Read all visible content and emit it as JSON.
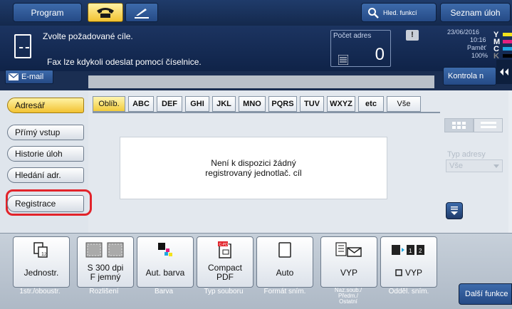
{
  "topbar": {
    "program_label": "Program",
    "search_label": "Hled. funkcí",
    "job_list_label": "Seznam úloh"
  },
  "info": {
    "line1": "Zvolte požadované cíle.",
    "line2": "Fax lze kdykoli odeslat pomocí číselnice.",
    "address_count_label": "Počet adres",
    "address_count": "0",
    "date": "23/06/2016",
    "time": "10:16",
    "memory_label": "Paměť",
    "memory_value": "100%",
    "toner": {
      "y": "Y",
      "m": "M",
      "c": "C",
      "k": "K"
    },
    "toner_colors": {
      "y": "#f3e21c",
      "m": "#e2207f",
      "c": "#1fa6e0",
      "k": "#000000"
    }
  },
  "strip": {
    "email_label": "E-mail",
    "check_label": "Kontrola n"
  },
  "left_menu": [
    {
      "label": "Adresář",
      "active": true
    },
    {
      "label": "Přímý vstup",
      "active": false
    },
    {
      "label": "Historie úloh",
      "active": false
    },
    {
      "label": "Hledání adr.",
      "active": false
    },
    {
      "label": "Registrace",
      "active": false
    }
  ],
  "tabs": [
    "Oblíb.",
    "ABC",
    "DEF",
    "GHI",
    "JKL",
    "MNO",
    "PQRS",
    "TUV",
    "WXYZ",
    "etc",
    "Vše"
  ],
  "message": {
    "line1": "Není k dispozici žádný",
    "line2": "registrovaný jednotlač. cíl"
  },
  "address_type": {
    "label": "Typ adresy",
    "value": "Vše"
  },
  "functions": [
    {
      "value": "Jednostr.",
      "caption": "1str./oboustr.",
      "icon": "single-sided-icon"
    },
    {
      "value": "S 300 dpi\nF jemný",
      "caption": "Rozlišení",
      "icon": "resolution-icon"
    },
    {
      "value": "Aut. barva",
      "caption": "Barva",
      "icon": "color-icon"
    },
    {
      "value": "Compact\nPDF",
      "caption": "Typ souboru",
      "icon": "pdf-icon"
    },
    {
      "value": "Auto",
      "caption": "Formát sním.",
      "icon": "page-icon"
    },
    {
      "value": "VYP",
      "caption": "Naz.soub./\nPředm./\nOstatní",
      "icon": "email-icon"
    },
    {
      "value": "VYP",
      "caption": "Odděl. sním.",
      "icon": "separate-scan-icon"
    }
  ],
  "more_functions_label": "Další funkce",
  "colors": {
    "highlight_ring": "#e2232a",
    "accent_yellow": "#f2c231",
    "dark_blue": "#14294d"
  }
}
